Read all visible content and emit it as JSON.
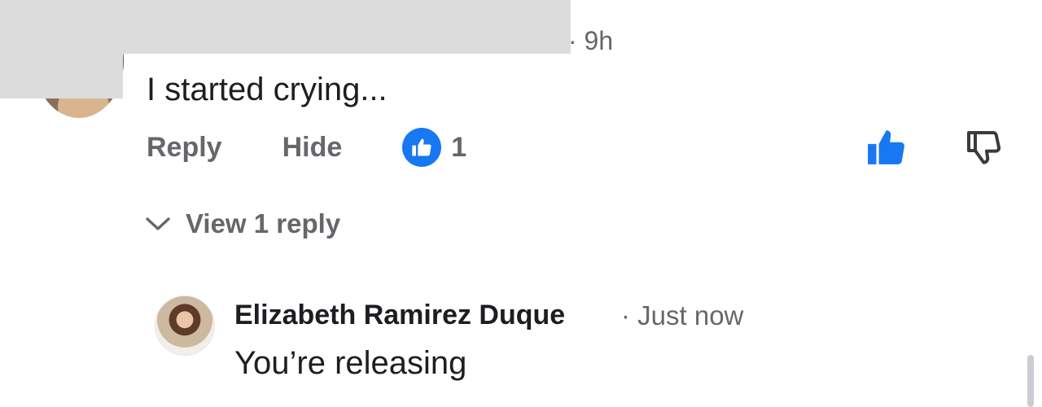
{
  "comment1": {
    "timestamp": "· 9h",
    "text": "I started crying...",
    "actions": {
      "reply": "Reply",
      "hide": "Hide"
    },
    "reaction_count": "1",
    "view_replies": "View 1 reply"
  },
  "comment2": {
    "author": "Elizabeth Ramirez Duque",
    "timestamp": "· Just now",
    "text": "You’re releasing"
  },
  "colors": {
    "accent": "#1877f2",
    "secondary_text": "#65676b",
    "primary_text": "#1c1e21",
    "redaction": "#dcdcdc"
  }
}
